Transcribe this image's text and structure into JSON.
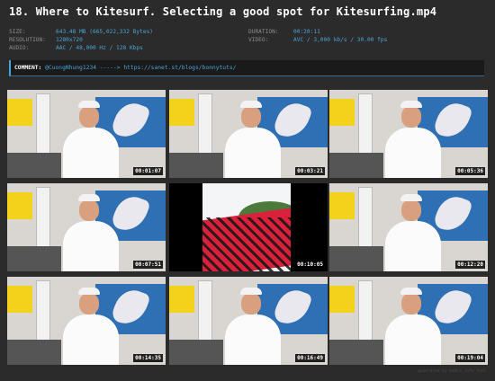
{
  "title": "18. Where to Kitesurf. Selecting a good spot for Kitesurfing.mp4",
  "meta": {
    "size_label": "SIZE:",
    "size_value": "643.48 MB (665,022,332 Bytes)",
    "resolution_label": "RESOLUTION:",
    "resolution_value": "1280x720",
    "audio_label": "AUDIO:",
    "audio_value": "AAC / 48,000 Hz / 128 Kbps",
    "duration_label": "DURATION:",
    "duration_value": "00:20:11",
    "video_label": "VIDEO:",
    "video_value": "AVC / 3,000 kb/s / 30.00 fps"
  },
  "comment": {
    "label": "COMMENT:",
    "text": "@CuongNhung1234 -----> https://sanet.st/blogs/bonnytuts/"
  },
  "thumbnails": [
    {
      "timestamp": "00:01:07",
      "type": "talking-head"
    },
    {
      "timestamp": "00:03:21",
      "type": "talking-head"
    },
    {
      "timestamp": "00:05:36",
      "type": "talking-head"
    },
    {
      "timestamp": "00:07:51",
      "type": "talking-head"
    },
    {
      "timestamp": "00:10:05",
      "type": "kite-photo"
    },
    {
      "timestamp": "00:12:20",
      "type": "talking-head"
    },
    {
      "timestamp": "00:14:35",
      "type": "talking-head"
    },
    {
      "timestamp": "00:16:49",
      "type": "talking-head"
    },
    {
      "timestamp": "00:19:04",
      "type": "talking-head"
    }
  ],
  "watermark": "generated by media info tool"
}
